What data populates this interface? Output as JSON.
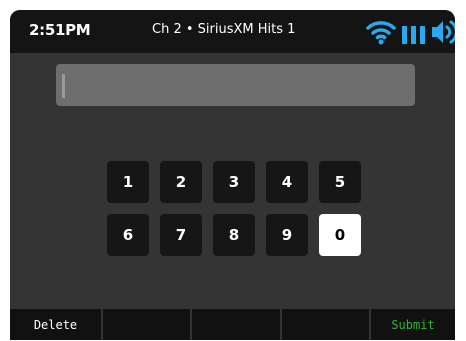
{
  "status": {
    "time": "2:51PM",
    "channel": "Ch 2 • SiriusXM Hits 1",
    "icons": [
      "wifi-icon",
      "signal-bars-icon",
      "volume-icon"
    ],
    "icon_color": "#29a9f0"
  },
  "entry": {
    "value": ""
  },
  "keypad": {
    "keys": [
      "1",
      "2",
      "3",
      "4",
      "5",
      "6",
      "7",
      "8",
      "9",
      "0"
    ],
    "selected": "0"
  },
  "softkeys": {
    "delete": "Delete",
    "blank1": "",
    "blank2": "",
    "blank3": "",
    "submit": "Submit",
    "submit_color": "#35b035"
  }
}
